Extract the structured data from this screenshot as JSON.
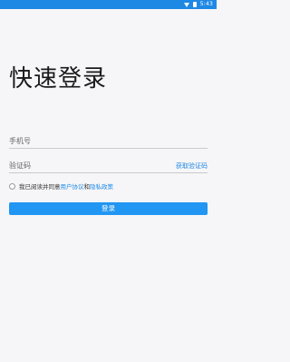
{
  "status_bar": {
    "time": "5:43",
    "background_color": "#1e88e5"
  },
  "page": {
    "title": "快速登录"
  },
  "phone_field": {
    "placeholder": "手机号",
    "value": ""
  },
  "code_field": {
    "placeholder": "验证码",
    "value": "",
    "get_code_label": "获取验证码"
  },
  "agreement": {
    "checked": false,
    "prefix": "我已阅读并同意",
    "user_agreement": "用户协议",
    "and": "和",
    "privacy_policy": "隐私政策"
  },
  "login_button": {
    "label": "登录"
  },
  "colors": {
    "accent": "#2196f3",
    "link": "#1e88e5"
  }
}
